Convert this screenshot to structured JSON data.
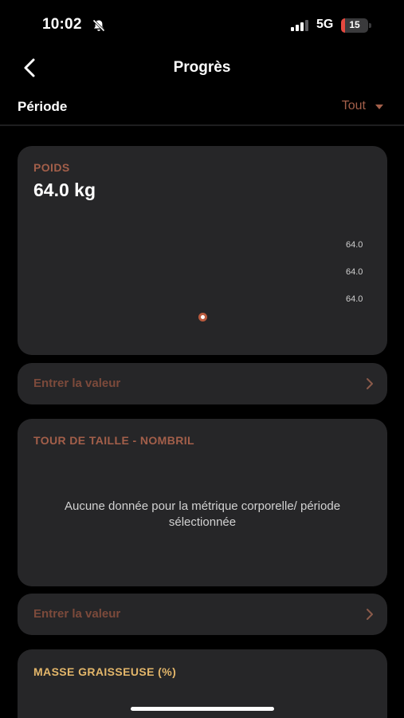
{
  "status_bar": {
    "time": "10:02",
    "network": "5G",
    "battery": "15",
    "battery_level": 0.15,
    "icons": [
      "bell-slash-icon",
      "signal-bars-icon",
      "battery-icon"
    ]
  },
  "header": {
    "title": "Progrès",
    "back_icon": "chevron-left-icon"
  },
  "period": {
    "label": "Période",
    "value": "Tout"
  },
  "weight_card": {
    "label": "POIDS",
    "value": "64.0 kg",
    "y_ticks": [
      "64.0",
      "64.0",
      "64.0"
    ]
  },
  "entry": {
    "label": "Entrer la valeur"
  },
  "waist_card": {
    "label": "TOUR DE TAILLE - NOMBRIL",
    "empty_message": "Aucune donnée pour la métrique corporelle/ période sélectionnée"
  },
  "fat_card": {
    "label": "MASSE GRAISSEUSE (%)"
  },
  "colors": {
    "background": "#000000",
    "card": "#262628",
    "accent": "#a35f4a",
    "fat_label": "#e3b66a",
    "battery_low": "#e5483f"
  }
}
